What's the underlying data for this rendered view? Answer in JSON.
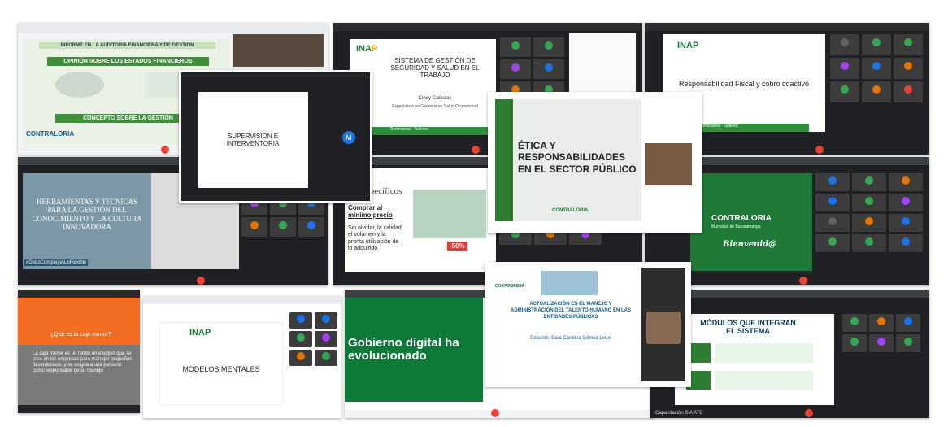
{
  "tiles": {
    "t1": {
      "title1": "INFORME EN LA AUDITORIA FINANCIERA Y DE GESTION",
      "title2": "OPINIÓN SOBRE LOS ESTADOS FINANCIEROS",
      "title3": "CONCEPTO SOBRE LA GESTIÓN",
      "logo": "CONTRALORIA"
    },
    "t2": {
      "title": "SISTEMA DE GESTIÓN DE SEGURIDAD Y SALUD EN EL TRABAJO",
      "author": "Cindy Cabezas",
      "role": "Especialista en Gerencia en Salud Ocupacional",
      "footer": "Seminarios · Talleres"
    },
    "t3": {
      "title": "SUPERVISION E INTERVENTORIA",
      "avatar": "M"
    },
    "t4": {
      "logo": "INAP",
      "title": "Responsabilidad Fiscal y cobro coactivo",
      "footer": "Seminarios · Talleres"
    },
    "t5": {
      "title": "ÉTICA Y RESPONSABILIDADES EN EL SECTOR PÚBLICO",
      "logo": "CONTRALORIA"
    },
    "t6": {
      "title": "HERRAMIENTAS Y TÉCNICAS PARA LA GESTIÓN DEL CONOCIMIENTO Y LA CULTURA INNOVADORA",
      "hashtag": "#DeLoComplejoALoFlexible"
    },
    "t7": {
      "header": "tos específicos",
      "sub": "Comprar al mínimo precio",
      "body": "Sin olvidar, la calidad, el volumen y la pronta utilización de lo adquirido.",
      "sale": "-50%"
    },
    "t8": {
      "logo": "CONTRALORIA",
      "sub": "Municipal de Bucaramanga",
      "welcome": "Bienvenid@"
    },
    "t9": {
      "question": "¿Qué es la caja menor?",
      "body": "La caja menor es un fondo en efectivo que se crea en las empresas para manejar pequeños desembolsos, y se asigna a una persona como responsable de su manejo"
    },
    "t10": {
      "logo": "INAP",
      "title": "MODELOS MENTALES"
    },
    "t11": {
      "title": "Gobierno digital ha evolucionado"
    },
    "t12": {
      "org": "CORPOGRESA",
      "title": "ACTUALIZACIÓN EN EL MANEJO Y ADMINISTRACIÓN DEL TALENTO HUMANO EN LAS ENTIDADES PÚBLICAS",
      "speaker": "Docente: Sara Carolina Gómez Lenis"
    },
    "t13": {
      "title": "MÓDULOS QUE INTEGRAN EL SISTEMA",
      "footer": "Capacitación SIA ATC"
    }
  },
  "colors": {
    "inap_green": "#1f7a3a",
    "inap_yellow": "#f2a900",
    "meet_dark": "#202124",
    "end_call": "#ea4335"
  }
}
